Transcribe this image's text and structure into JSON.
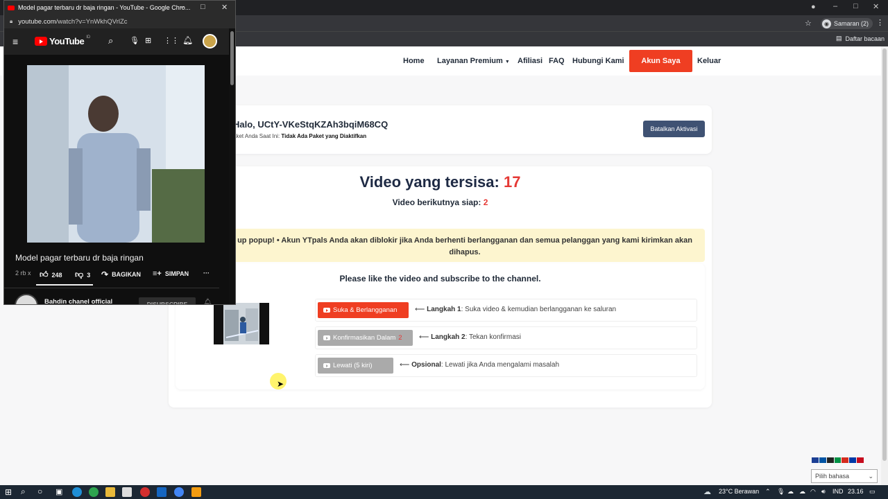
{
  "browser_main": {
    "profile_label": "Samaran (2)",
    "reading_list": "Daftar bacaan",
    "window_buttons": [
      "–",
      "□",
      "✕"
    ]
  },
  "nav": {
    "items": [
      "Home",
      "Layanan Premium",
      "Afiliasi",
      "FAQ",
      "Hubungi Kami"
    ],
    "account_button": "Akun Saya",
    "logout": "Keluar"
  },
  "profile_card": {
    "greeting": "Halo, UCtY-VKeStqKZAh3bqiM68CQ",
    "package_label": "aket Anda Saat Ini:",
    "package_value": "Tidak Ada Paket yang Diaktifkan",
    "cancel_button": "Batalkan Aktivasi"
  },
  "counter": {
    "remaining_label": "Video yang tersisa:",
    "remaining_value": "17",
    "next_label": "Video berikutnya siap:",
    "next_value": "2"
  },
  "alert": {
    "text": "up popup! • Akun YTpals Anda akan diblokir jika Anda berhenti berlangganan dan semua pelanggan yang kami kirimkan akan dihapus."
  },
  "task": {
    "instruction": "Please like the video and subscribe to the channel.",
    "steps": [
      {
        "button": "Suka & Berlangganan",
        "button_suffix": "",
        "label": "Langkah 1",
        "desc": ": Suka video & kemudian berlangganan ke saluran",
        "color": "#ef3e22"
      },
      {
        "button": "Konfirmasikan Dalam",
        "button_suffix": "2",
        "label": "Langkah 2",
        "desc": ": Tekan konfirmasi",
        "color": "#aaaaaa"
      },
      {
        "button": "Lewati (5 kiri)",
        "button_suffix": "",
        "label": "Opsional",
        "desc": ": Lewati jika Anda mengalami masalah",
        "color": "#aaaaaa"
      }
    ],
    "arrow": "⟵"
  },
  "language": {
    "select_placeholder": "Pilih bahasa"
  },
  "youtube_popup": {
    "window_title": "Model pagar terbaru dr baja ringan - YouTube - Google Chro...",
    "url_host": "youtube.com",
    "url_path": "/watch?v=YnWkhQVrlZc",
    "logo_text": "YouTube",
    "logo_region": "ID",
    "video_title": "Model pagar terbaru dr baja ringan",
    "views": "2 rb x",
    "likes": "248",
    "dislikes": "3",
    "share_label": "BAGIKAN",
    "save_label": "SIMPAN",
    "more": "···",
    "channel_name": "Bahdin chanel official",
    "subscribe_label": "DISUBSCRIBE"
  },
  "taskbar": {
    "weather": "23°C  Berawan",
    "lang": "IND",
    "time": "23.16"
  },
  "colors": {
    "brand_red": "#ef3e22",
    "counter_red": "#e53935",
    "navy": "#1e2a44",
    "alert_bg": "#fdf5cf"
  }
}
